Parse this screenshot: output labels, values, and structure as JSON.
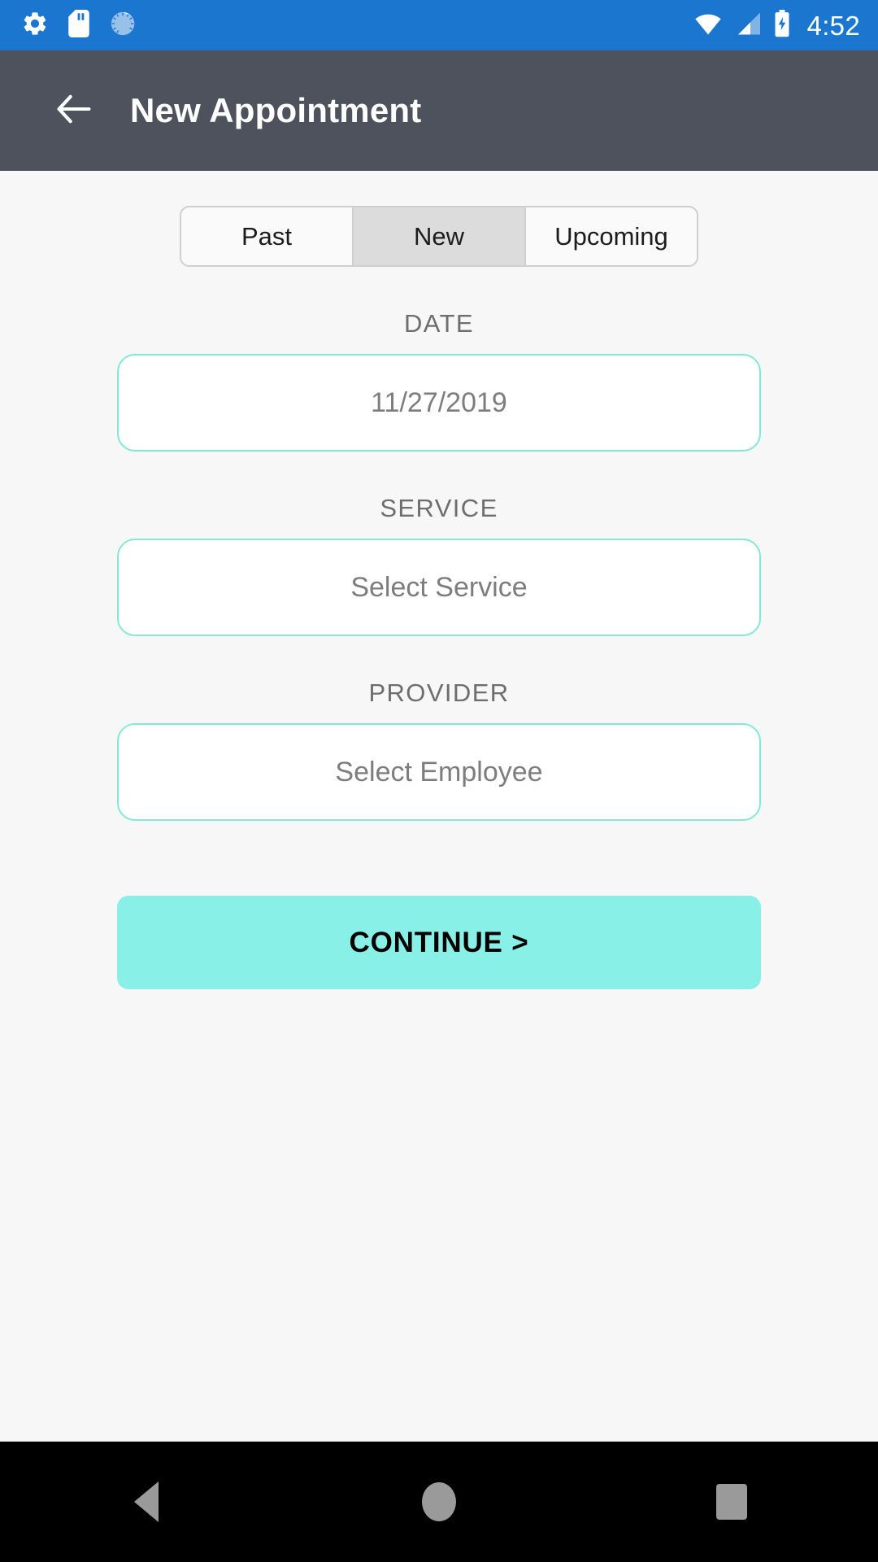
{
  "status_bar": {
    "background_color": "#1b76d0",
    "left_icons": [
      "gear-icon",
      "sd-card-icon",
      "sync-progress-icon"
    ],
    "right_icons": [
      "wifi-icon",
      "cellular-signal-icon",
      "battery-charging-icon"
    ],
    "time": "4:52"
  },
  "app_bar": {
    "background_color": "#4e525c",
    "back_icon": "arrow-back-icon",
    "title": "New Appointment"
  },
  "segmented_control": {
    "selected_index": 1,
    "segments": [
      {
        "label": "Past"
      },
      {
        "label": "New"
      },
      {
        "label": "Upcoming"
      }
    ]
  },
  "form": {
    "accent_color": "#84e8d6",
    "fields": [
      {
        "label": "DATE",
        "value": "11/27/2019",
        "name": "date"
      },
      {
        "label": "SERVICE",
        "value": "Select Service",
        "name": "service"
      },
      {
        "label": "PROVIDER",
        "value": "Select Employee",
        "name": "provider"
      }
    ],
    "continue_label": "CONTINUE >",
    "continue_color": "#88f0e6"
  },
  "nav_bar": {
    "background_color": "#000000",
    "buttons": [
      "back-triangle-icon",
      "home-circle-icon",
      "recents-square-icon"
    ]
  }
}
